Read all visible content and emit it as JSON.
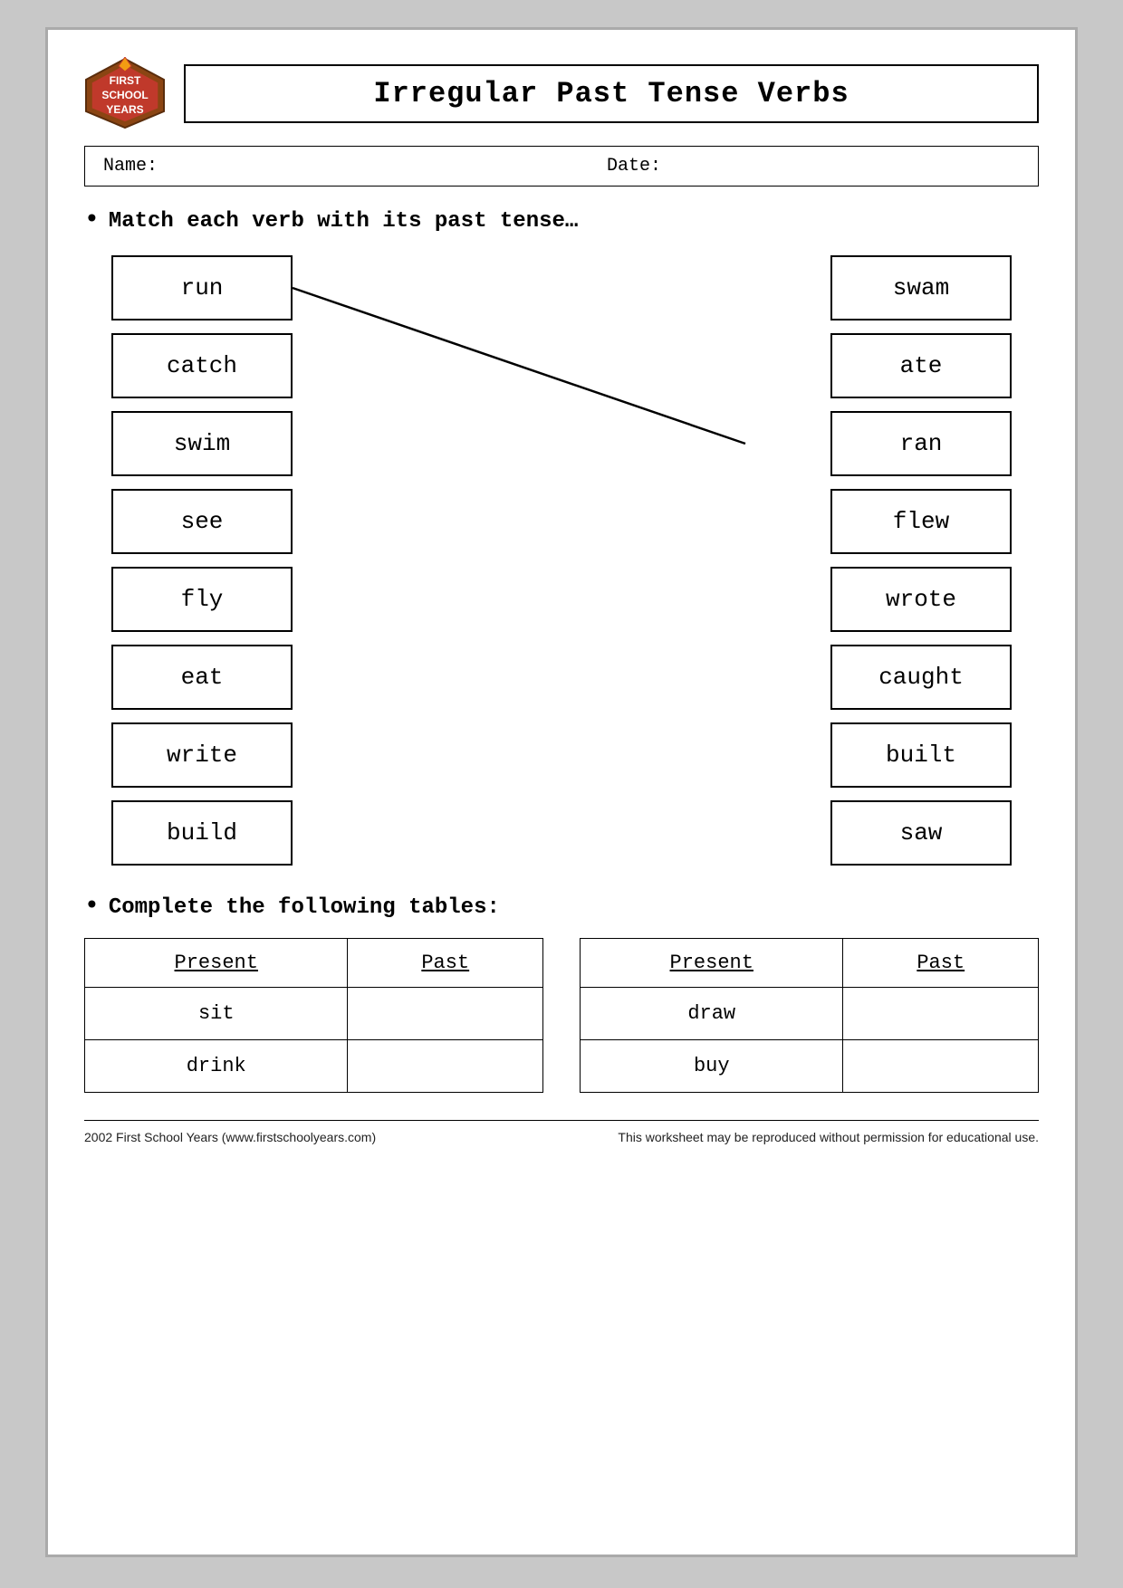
{
  "header": {
    "title": "Irregular Past Tense Verbs",
    "logo": {
      "line1": "FIRST",
      "line2": "SCHOOL",
      "line3": "YEARS"
    }
  },
  "nameDate": {
    "nameLabel": "Name:",
    "dateLabel": "Date:"
  },
  "instruction1": "Match each verb with its past tense…",
  "leftWords": [
    "run",
    "catch",
    "swim",
    "see",
    "fly",
    "eat",
    "write",
    "build"
  ],
  "rightWords": [
    "swam",
    "ate",
    "ran",
    "flew",
    "wrote",
    "caught",
    "built",
    "saw"
  ],
  "instruction2": "Complete the following tables:",
  "table1": {
    "headers": [
      "Present",
      "Past"
    ],
    "rows": [
      [
        "sit",
        ""
      ],
      [
        "drink",
        ""
      ]
    ]
  },
  "table2": {
    "headers": [
      "Present",
      "Past"
    ],
    "rows": [
      [
        "draw",
        ""
      ],
      [
        "buy",
        ""
      ]
    ]
  },
  "footer": {
    "left": "2002 First School Years  (www.firstschoolyears.com)",
    "right": "This worksheet may be reproduced without permission for educational use."
  }
}
